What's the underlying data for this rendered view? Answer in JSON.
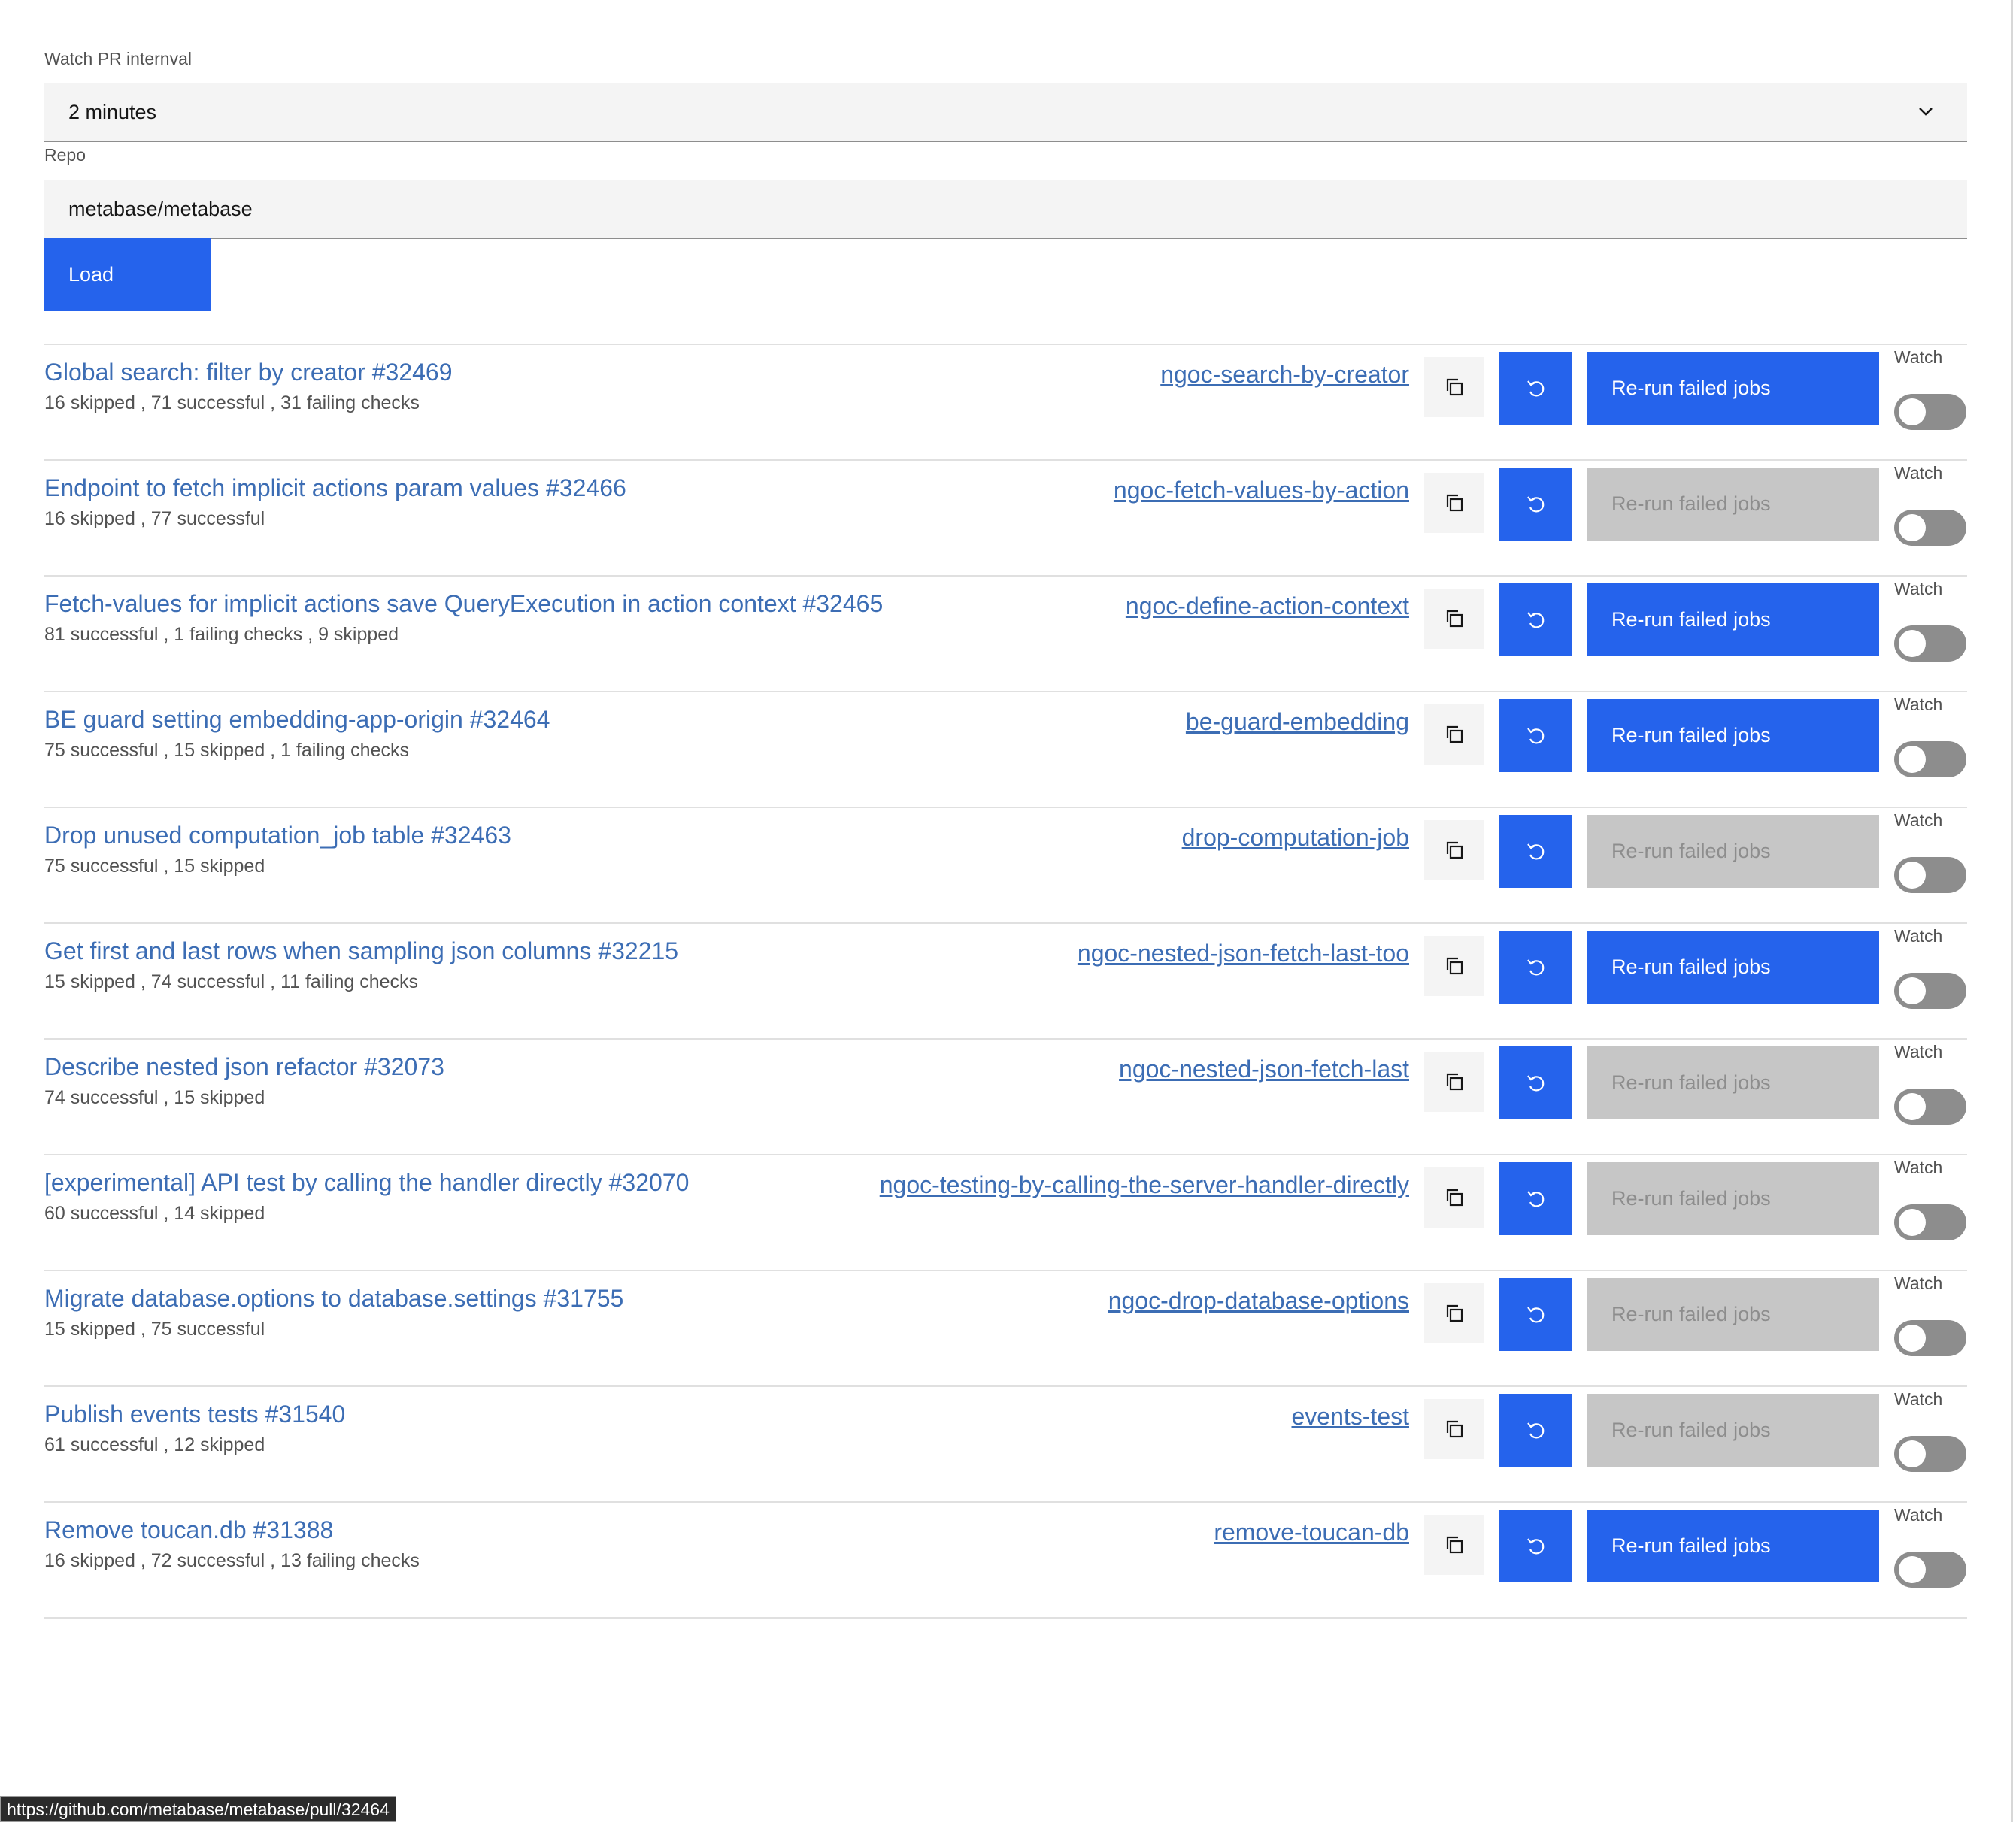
{
  "form": {
    "interval_label": "Watch PR internval",
    "interval_value": "2 minutes",
    "repo_label": "Repo",
    "repo_value": "metabase/metabase",
    "load_label": "Load"
  },
  "rerun_label": "Re-run failed jobs",
  "watch_label": "Watch",
  "prs": [
    {
      "title": "Global search: filter by creator #32469",
      "meta": "16 skipped , 71 successful , 31 failing checks",
      "branch": "ngoc-search-by-creator",
      "rerun_enabled": true,
      "watching": false
    },
    {
      "title": "Endpoint to fetch implicit actions param values #32466",
      "meta": "16 skipped , 77 successful",
      "branch": "ngoc-fetch-values-by-action",
      "rerun_enabled": false,
      "watching": false
    },
    {
      "title": "Fetch-values for implicit actions save QueryExecution in action context #32465",
      "meta": "81 successful , 1 failing checks , 9 skipped",
      "branch": "ngoc-define-action-context",
      "rerun_enabled": true,
      "watching": false
    },
    {
      "title": "BE guard setting embedding-app-origin #32464",
      "meta": "75 successful , 15 skipped , 1 failing checks",
      "branch": "be-guard-embedding",
      "rerun_enabled": true,
      "watching": false
    },
    {
      "title": "Drop unused computation_job table #32463",
      "meta": "75 successful , 15 skipped",
      "branch": "drop-computation-job",
      "rerun_enabled": false,
      "watching": false
    },
    {
      "title": "Get first and last rows when sampling json columns #32215",
      "meta": "15 skipped , 74 successful , 11 failing checks",
      "branch": "ngoc-nested-json-fetch-last-too",
      "rerun_enabled": true,
      "watching": false
    },
    {
      "title": "Describe nested json refactor #32073",
      "meta": "74 successful , 15 skipped",
      "branch": "ngoc-nested-json-fetch-last",
      "rerun_enabled": false,
      "watching": false
    },
    {
      "title": "[experimental] API test by calling the handler directly #32070",
      "meta": "60 successful , 14 skipped",
      "branch": "ngoc-testing-by-calling-the-server-handler-directly",
      "rerun_enabled": false,
      "watching": false
    },
    {
      "title": "Migrate database.options to database.settings #31755",
      "meta": "15 skipped , 75 successful",
      "branch": "ngoc-drop-database-options",
      "rerun_enabled": false,
      "watching": false
    },
    {
      "title": "Publish events tests #31540",
      "meta": "61 successful , 12 skipped",
      "branch": "events-test",
      "rerun_enabled": false,
      "watching": false
    },
    {
      "title": "Remove toucan.db #31388",
      "meta": "16 skipped , 72 successful , 13 failing checks",
      "branch": "remove-toucan-db",
      "rerun_enabled": true,
      "watching": false
    }
  ],
  "status_bar": {
    "url": "https://github.com/metabase/metabase/pull/32464"
  },
  "colors": {
    "primary": "#2563ec",
    "link": "#3c6db4",
    "disabled_bg": "#c6c6c6",
    "disabled_text": "#8d8d8d"
  }
}
